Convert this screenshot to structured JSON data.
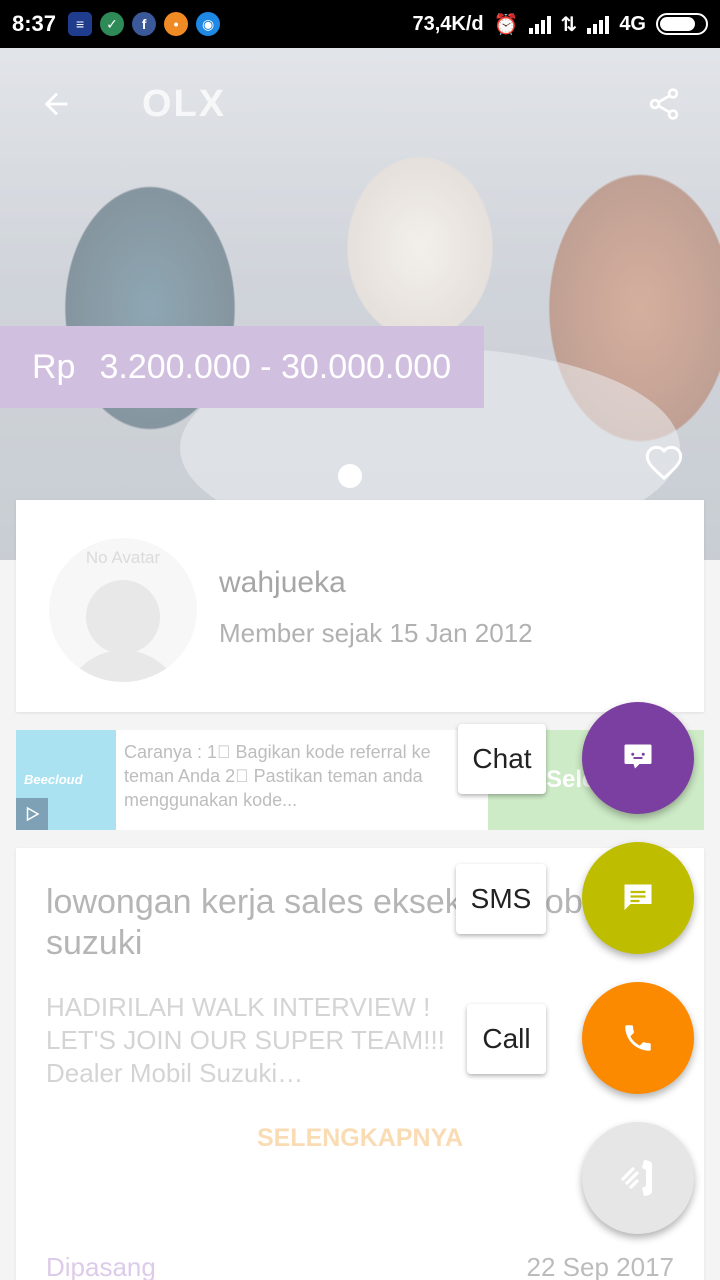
{
  "status_bar": {
    "time": "8:37",
    "net_speed": "73,4K/d",
    "network": "4G"
  },
  "app_bar": {
    "logo": "OLX"
  },
  "listing_header": {
    "currency": "Rp",
    "price_range": "3.200.000 - 30.000.000"
  },
  "seller": {
    "avatar_placeholder": "No Avatar",
    "name": "wahjueka",
    "member_since": "Member sejak 15 Jan 2012"
  },
  "ad_banner": {
    "brand": "Beecloud",
    "text": "Caranya : 1⃣ Bagikan kode referral ke teman Anda 2⃣ Pastikan teman anda menggunakan kode...",
    "cta_partial": "Seleng"
  },
  "listing": {
    "title": "lowongan kerja sales eksekutif mobil suzuki",
    "description": "HADIRILAH WALK INTERVIEW ! LET'S JOIN OUR SUPER TEAM!!! Dealer Mobil Suzuki…",
    "more_label": "SELENGKAPNYA",
    "posted_label": "Dipasang",
    "posted_date": "22 Sep 2017"
  },
  "contact_actions": {
    "chat_label": "Chat",
    "sms_label": "SMS",
    "call_label": "Call"
  },
  "colors": {
    "chat_fab": "#7b3fa1",
    "sms_fab": "#bfbd00",
    "call_fab": "#fb8a00",
    "close_fab": "#e6e6e6",
    "price_tag": "#b79dcd"
  },
  "icons": [
    "message-icon",
    "sms-icon",
    "phone-icon",
    "close-call-icon",
    "back-arrow-icon",
    "share-icon",
    "heart-icon"
  ]
}
